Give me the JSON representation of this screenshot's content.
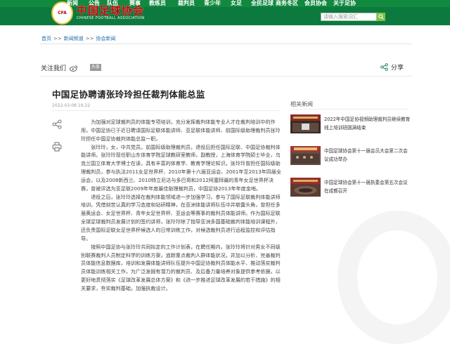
{
  "header": {
    "logo_cn": "中国足球协会",
    "logo_en": "CHINESE FOOTBALL ASSOCIATION",
    "logo_badge_text": "CFA",
    "nav": [
      "新闻",
      "公告",
      "队伍",
      "赛事",
      "教练员",
      "裁判员",
      "青少年",
      "女足",
      "全民足球",
      "商务冬区",
      "会员协会",
      "关于足协"
    ],
    "search_placeholder": "请输入搜索词汇",
    "search_icon": "search-icon"
  },
  "breadcrumb": [
    "首页",
    "新闻频道",
    "协会新闻"
  ],
  "breadcrumb_sep": ">>",
  "share_row": {
    "follow_label": "关注我们",
    "toutiao_label": "头条",
    "share_label": "分享"
  },
  "article": {
    "title": "中国足协聘请张玲玲担任裁判体能总监",
    "date": "2022-03-08 16:22",
    "paragraphs": [
      "为加强对足球裁判员的体能专项培训，充分发挥裁判体能专业人才在裁判培训中的作用，中国足协已于近日聘请国际足联体能讲师、亚足联体能讲师、前国际级助理裁判员张玲玲担任中国足协裁判体能总监一职。",
      "张玲玲，女，中共党员。前国际级助理裁判员，退役后担任国际足联、中国足协裁判体能讲师。张玲玲现任职山东体育学院足球教研室教师，副教授，上海体育学院硕士毕业，乌克兰国立体育大学博士在读，具有丰富的体育学、教育学理论知识。张玲玲曾担任国际级助理裁判员，参与执法2011女足世界杯、2010年第十六届亚运会、2001年至2013年四届全运会，以及2008新西兰、2010特立尼达与多巴哥和2012阿塞拜疆的青年女足世界杯决赛，曾被评选为亚足联2009年年度最佳助理裁判员，中国足协2013年年度金哨。",
      "退役之后，张玲玲选择在裁判体能领域进一步加强学习，参与了国际足联裁判体能讲师培训，凭借刻苦认真的学习态度和钻研精神，在亚洲体能讲师队伍中并崭露头角，曾担任多届奥运会、女足世界杯、青年女足世界杯、亚运会等赛事的裁判员体能讲师。作为国际足联全球足球裁判员发展计划的签约讲师，张玲玲除了指导亚洲多国基础裁判体能培训课程外，还负责国际足联女足世界杯候选人的日常训练工作，对候选裁判员进行远程监控和评估指导。",
      "按照中国足协与张玲玲共同拟定的工作计划表，在聘任期内，张玲玲将针对男女不同级别联赛裁判人员制定科学的训练方案，追踪重点裁判人群体能状况，并加以分析、完善裁判员体能信息数据库，培训和发展体能讲师队伍提升中国足协裁判员体能水平、推动落实裁判员体能训练相关工作，为广泛发掘有潜力的裁判员、及后备力量培养对象提供参考依据，以更好地贯彻落实《足球改革发展总体方案》和《进一步推进足球改革发展的若干措施》的相关要求，夯实裁判基础，加强执裁设计。"
    ]
  },
  "related": {
    "title": "相关新闻",
    "items": [
      {
        "text": "2022年中国足协视频助理裁判员继续教育线上培训班圆满结束"
      },
      {
        "text": "中国足球协会第十一届会员大会第二次会议成功举办"
      },
      {
        "text": "中国足球协会第十一届执委会第五次会议在成都召开"
      }
    ]
  },
  "colors": {
    "header_green": "#0c7a3e",
    "link_blue": "#1a6fb0",
    "logo_red": "#c00"
  }
}
